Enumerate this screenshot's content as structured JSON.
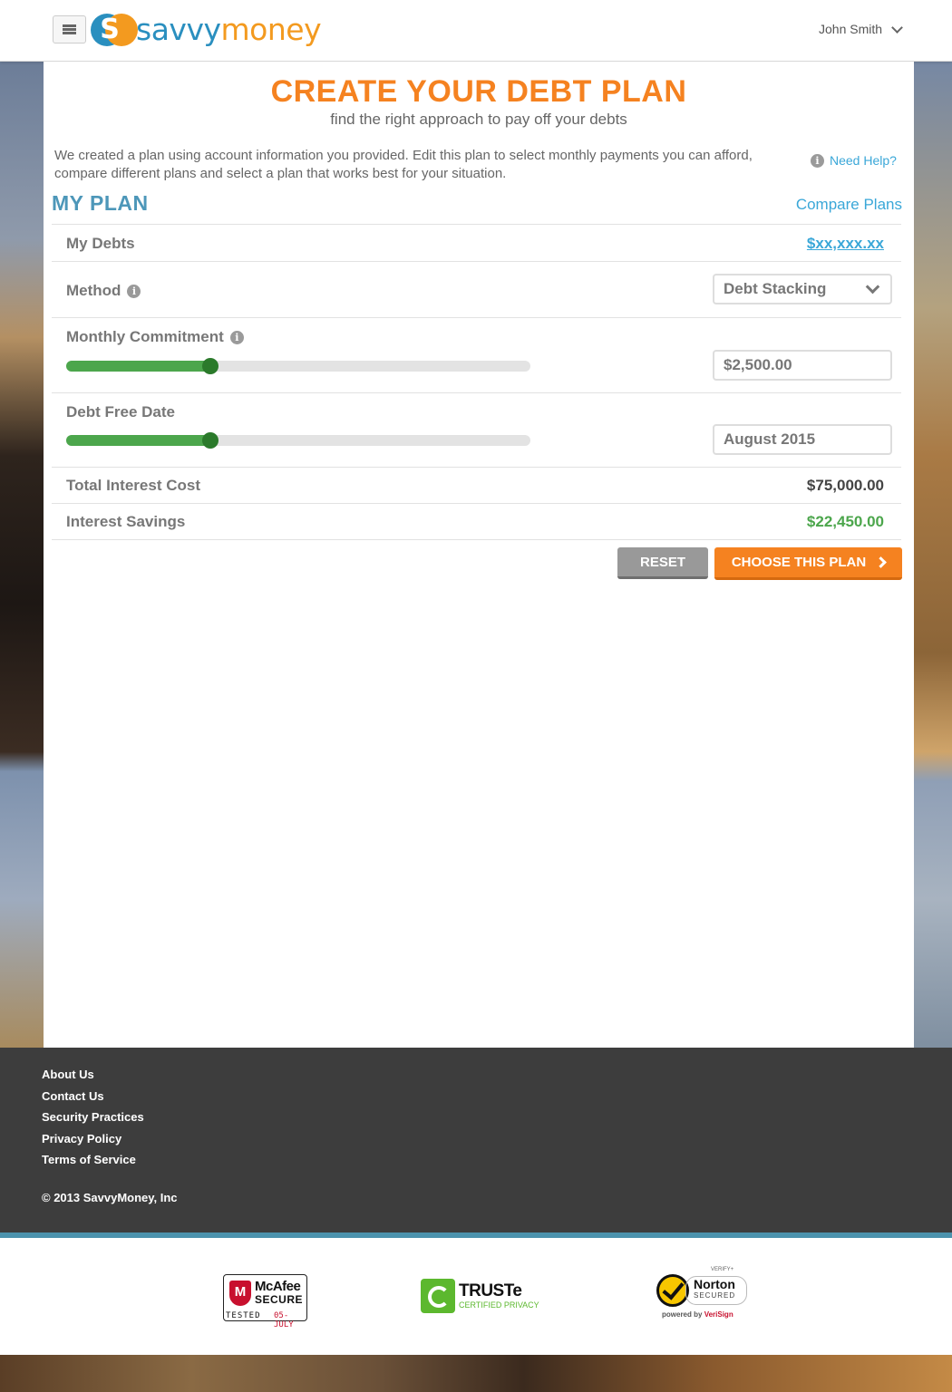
{
  "header": {
    "menu_icon": "hamburger-menu-icon",
    "logo": {
      "savvy": "savvy",
      "money": "money",
      "mark": "S"
    },
    "user_name": "John Smith"
  },
  "page": {
    "title": "CREATE YOUR DEBT PLAN",
    "subtitle": "find the right approach to pay off your debts",
    "intro": "We created a plan using account information you provided. Edit this plan to select monthly payments you can afford, compare different plans and select a plan that works best for your situation.",
    "help_link": "Need Help?"
  },
  "plan": {
    "heading": "MY PLAN",
    "compare_link": "Compare Plans",
    "my_debts": {
      "label": "My Debts",
      "value": "$xx,xxx.xx"
    },
    "method": {
      "label": "Method",
      "selected": "Debt Stacking"
    },
    "monthly_commitment": {
      "label": "Monthly Commitment",
      "value": "$2,500.00",
      "slider_fraction": 0.31
    },
    "debt_free_date": {
      "label": "Debt Free Date",
      "value": "August 2015",
      "slider_fraction": 0.31
    },
    "total_interest_cost": {
      "label": "Total Interest Cost",
      "value": "$75,000.00"
    },
    "interest_savings": {
      "label": "Interest Savings",
      "value": "$22,450.00"
    },
    "reset_label": "RESET",
    "choose_label": "CHOOSE THIS PLAN"
  },
  "footer": {
    "links": [
      "About Us",
      "Contact Us",
      "Security Practices",
      "Privacy Policy",
      "Terms of Service"
    ],
    "copyright": "© 2013 SavvyMoney, Inc"
  },
  "badges": {
    "mcafee": {
      "mark": "M",
      "name": "McAfee",
      "secure": "SECURE",
      "tested": "TESTED",
      "date": "05-JULY"
    },
    "truste": {
      "name": "TRUSTe",
      "sub": "CERTIFIED PRIVACY"
    },
    "norton": {
      "verify": "VERIFY+",
      "name": "Norton",
      "secured": "SECURED",
      "powered": "powered by",
      "verisign": "VeriSign"
    }
  },
  "colors": {
    "accent_orange": "#f58220",
    "accent_blue": "#3aa7d8",
    "heading_blue": "#4d97b9",
    "savings_green": "#4ca64c",
    "slider_knob": "#2b7a2b",
    "footer_bg": "#3d3d3d"
  }
}
